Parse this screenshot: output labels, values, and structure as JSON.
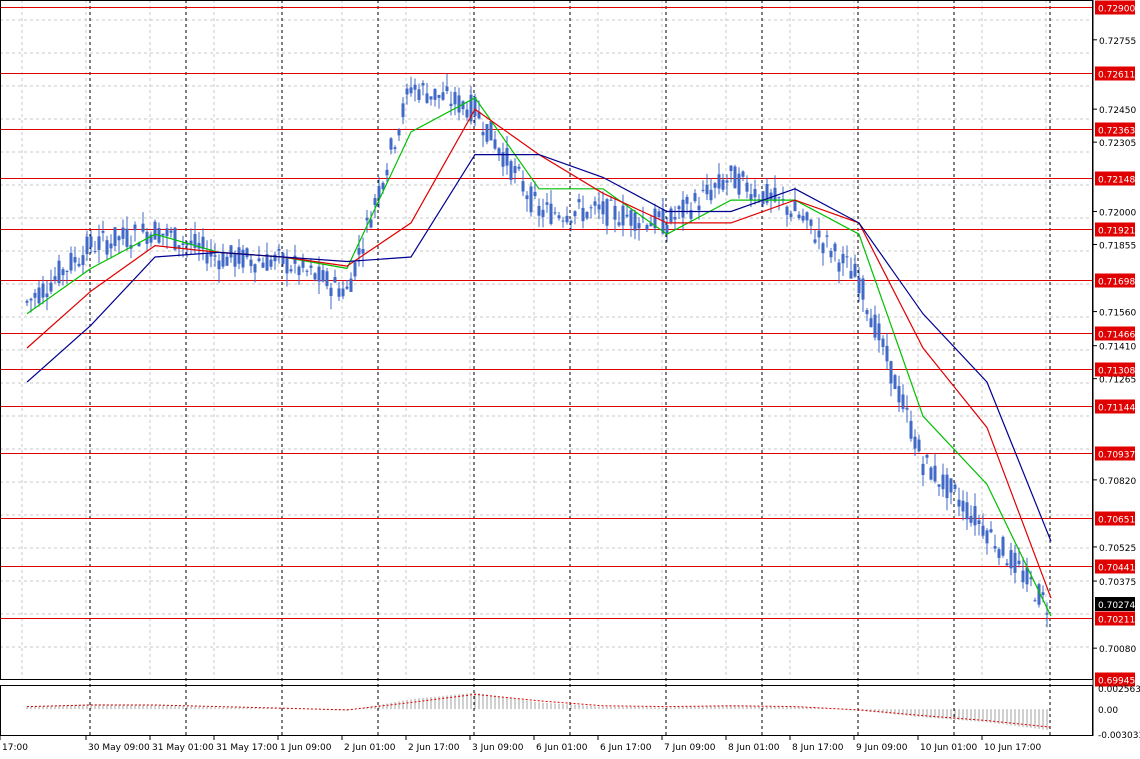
{
  "colors": {
    "background": "#ffffff",
    "grid": "#c8c8c8",
    "separator": "#000000",
    "candle": "#4169c8",
    "level_line": "#e00000",
    "level_label_bg": "#e00000",
    "level_label_text": "#ffffff",
    "price_label_bg": "#000000",
    "ma_fast": "#00c000",
    "ma_medium": "#e00000",
    "ma_slow": "#000090",
    "histogram": "#a0a0a0",
    "signal": "#e00000"
  },
  "price_axis": {
    "ticks": [
      "0.72755",
      "0.72450",
      "0.72305",
      "0.72000",
      "0.71855",
      "0.71560",
      "0.71410",
      "0.71265",
      "0.70820",
      "0.70525",
      "0.70375",
      "0.70080"
    ],
    "range": [
      0.6994,
      0.7293
    ]
  },
  "horizontal_levels": [
    "0.72900",
    "0.72611",
    "0.72363",
    "0.72148",
    "0.71921",
    "0.71698",
    "0.71466",
    "0.71308",
    "0.71144",
    "0.70937",
    "0.70651",
    "0.70441",
    "0.70211",
    "0.69945"
  ],
  "current_price": "0.70274",
  "indicator_axis": {
    "ticks": [
      "0.002563",
      "0.00",
      "-0.003033"
    ],
    "range": [
      -0.003033,
      0.002563
    ]
  },
  "time_axis": [
    "17:00",
    "30 May 09:00",
    "31 May 01:00",
    "31 May 17:00",
    "1 Jun 09:00",
    "2 Jun 01:00",
    "2 Jun 17:00",
    "3 Jun 09:00",
    "6 Jun 01:00",
    "6 Jun 17:00",
    "7 Jun 09:00",
    "8 Jun 01:00",
    "8 Jun 17:00",
    "9 Jun 09:00",
    "10 Jun 01:00",
    "10 Jun 17:00"
  ],
  "chart_data": {
    "type": "candlestick",
    "series": [
      {
        "role": "price",
        "x": [
          "17:00",
          "30 May 09:00",
          "31 May 01:00",
          "31 May 17:00",
          "1 Jun 09:00",
          "2 Jun 01:00",
          "2 Jun 17:00",
          "3 Jun 09:00",
          "6 Jun 01:00",
          "6 Jun 17:00",
          "7 Jun 09:00",
          "8 Jun 01:00",
          "8 Jun 17:00",
          "9 Jun 09:00",
          "10 Jun 01:00",
          "10 Jun 17:00",
          "end"
        ],
        "values": [
          0.716,
          0.7185,
          0.7192,
          0.718,
          0.7178,
          0.7165,
          0.7255,
          0.7245,
          0.72,
          0.72,
          0.7195,
          0.7215,
          0.72,
          0.717,
          0.709,
          0.706,
          0.7025
        ]
      },
      {
        "role": "ma_fast",
        "values": [
          0.7155,
          0.7175,
          0.719,
          0.7182,
          0.718,
          0.7175,
          0.7235,
          0.725,
          0.721,
          0.721,
          0.719,
          0.7205,
          0.7205,
          0.719,
          0.711,
          0.708,
          0.7022
        ]
      },
      {
        "role": "ma_medium",
        "values": [
          0.714,
          0.7165,
          0.7185,
          0.7182,
          0.718,
          0.7176,
          0.7195,
          0.7245,
          0.7225,
          0.7208,
          0.7195,
          0.7195,
          0.7205,
          0.7195,
          0.714,
          0.7105,
          0.703
        ]
      },
      {
        "role": "ma_slow",
        "values": [
          0.7125,
          0.715,
          0.718,
          0.7182,
          0.718,
          0.7178,
          0.718,
          0.7225,
          0.7225,
          0.7215,
          0.72,
          0.72,
          0.721,
          0.7195,
          0.7155,
          0.7125,
          0.7055
        ]
      },
      {
        "role": "oscillator",
        "values": [
          0.0003,
          0.0006,
          0.0005,
          0.0002,
          0.0001,
          -0.0002,
          0.0012,
          0.002,
          0.0008,
          0.0003,
          0.0002,
          0.0005,
          0.0003,
          -0.0002,
          -0.001,
          -0.0016,
          -0.0026
        ]
      },
      {
        "role": "signal",
        "values": [
          0.0003,
          0.0005,
          0.0005,
          0.0003,
          0.0001,
          -0.0001,
          0.0008,
          0.0018,
          0.001,
          0.0004,
          0.0003,
          0.0004,
          0.0003,
          -0.0001,
          -0.0008,
          -0.0014,
          -0.0022
        ]
      }
    ]
  }
}
